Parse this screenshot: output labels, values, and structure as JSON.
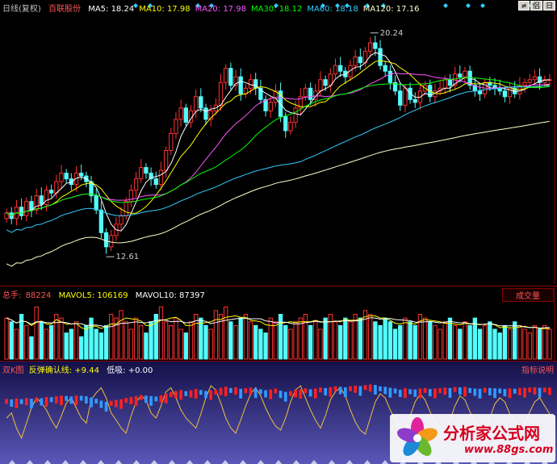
{
  "main": {
    "period": "日线(复权)",
    "stock": "百联股份",
    "ma": [
      {
        "label": "MA5: 18.24",
        "color": "#ffffff"
      },
      {
        "label": "MA10: 17.98",
        "color": "#ffff00"
      },
      {
        "label": "MA20: 17.98",
        "color": "#ff55ff"
      },
      {
        "label": "MA30: 18.12",
        "color": "#00ff00"
      },
      {
        "label": "MA60: 18.18",
        "color": "#33ccff"
      },
      {
        "label": "MA120: 17.16",
        "color": "#ffffcc"
      }
    ],
    "high_label": "20.24",
    "low_label": "12.61",
    "toolbar": [
      "≠",
      "侣",
      "日"
    ]
  },
  "volume": {
    "name": "总手:",
    "value": "88224",
    "mavol5": "MAVOL5: 106169",
    "mavol10": "MAVOL10: 87397",
    "tag": "成交量"
  },
  "indicator": {
    "name": "双K图",
    "confirm": "反弹确认线: +9.44",
    "low": "低吸: +0.00",
    "tag": "指标说明"
  },
  "watermark": {
    "title": "分析家公式网",
    "url": "www.88gs.com"
  },
  "colors": {
    "up": "#ff3232",
    "down": "#54fcfc",
    "bg": "#000000"
  },
  "chart_data": {
    "type": "candlestick",
    "y_range": [
      11.8,
      21.2
    ],
    "x_count": 110,
    "price_close": [
      14.2,
      14.0,
      14.4,
      14.1,
      14.6,
      14.3,
      14.8,
      14.5,
      15.0,
      14.9,
      15.3,
      15.6,
      15.4,
      15.2,
      15.6,
      15.5,
      15.3,
      14.8,
      14.3,
      13.5,
      13.0,
      13.4,
      13.8,
      14.1,
      14.6,
      15.0,
      15.4,
      15.8,
      15.6,
      15.4,
      15.2,
      15.7,
      16.4,
      17.0,
      17.5,
      17.9,
      17.4,
      17.8,
      18.3,
      17.9,
      17.5,
      17.8,
      18.0,
      18.8,
      19.3,
      18.7,
      19.0,
      18.4,
      18.6,
      18.9,
      18.6,
      18.2,
      17.8,
      18.1,
      18.5,
      17.6,
      17.1,
      17.4,
      17.9,
      18.3,
      18.6,
      18.2,
      18.5,
      18.9,
      18.7,
      19.1,
      19.4,
      19.2,
      19.0,
      19.4,
      19.7,
      19.5,
      19.9,
      20.2,
      20.0,
      19.4,
      19.2,
      18.8,
      18.5,
      18.0,
      18.6,
      18.2,
      18.1,
      18.5,
      18.7,
      18.3,
      18.5,
      18.6,
      18.9,
      18.7,
      19.1,
      19.0,
      19.2,
      18.7,
      18.5,
      18.4,
      18.8,
      18.7,
      18.6,
      18.5,
      18.3,
      18.6,
      18.4,
      18.7,
      18.8,
      18.9,
      19.0,
      18.8,
      18.9,
      18.9
    ],
    "ma_series": [
      "MA5",
      "MA10",
      "MA20",
      "MA30",
      "MA60",
      "MA120"
    ],
    "volume": [
      11,
      10,
      8,
      12,
      9,
      6,
      14,
      10,
      8,
      9,
      12,
      11,
      7,
      8,
      10,
      6,
      9,
      11,
      8,
      7,
      9,
      12,
      11,
      13,
      10,
      8,
      11,
      9,
      7,
      10,
      12,
      14,
      10,
      9,
      11,
      8,
      7,
      10,
      12,
      11,
      9,
      8,
      13,
      12,
      14,
      10,
      9,
      11,
      12,
      10,
      9,
      8,
      7,
      11,
      10,
      12,
      9,
      8,
      10,
      11,
      12,
      9,
      10,
      8,
      11,
      12,
      10,
      9,
      11,
      10,
      12,
      11,
      13,
      12,
      10,
      9,
      11,
      10,
      8,
      9,
      11,
      10,
      9,
      12,
      11,
      10,
      9,
      8,
      10,
      11,
      9,
      8,
      10,
      9,
      11,
      8,
      9,
      10,
      8,
      7,
      9,
      8,
      10,
      9,
      8,
      7,
      9,
      8,
      9,
      8
    ],
    "mavol5_value": 106169,
    "mavol10_value": 87397,
    "indicator_line": [
      40,
      45,
      30,
      20,
      35,
      50,
      60,
      55,
      48,
      38,
      30,
      42,
      55,
      60,
      50,
      40,
      35,
      58,
      65,
      70,
      60,
      45,
      38,
      30,
      25,
      42,
      56,
      62,
      58,
      45,
      40,
      52,
      66,
      70,
      60,
      48,
      40,
      35,
      30,
      44,
      60,
      72,
      68,
      55,
      40,
      30,
      25,
      38,
      52,
      64,
      70,
      62,
      50,
      40,
      32,
      28,
      40,
      56,
      68,
      72,
      60,
      48,
      38,
      30,
      42,
      58,
      66,
      70,
      62,
      48,
      36,
      28,
      24,
      40,
      56,
      64,
      60,
      48,
      38,
      30,
      28,
      42,
      56,
      64,
      58,
      46,
      36,
      30,
      26,
      38,
      52,
      62,
      58,
      46,
      36,
      30,
      28,
      40,
      54,
      60,
      56,
      44,
      36,
      30,
      34,
      46,
      56,
      60,
      52,
      44
    ]
  }
}
